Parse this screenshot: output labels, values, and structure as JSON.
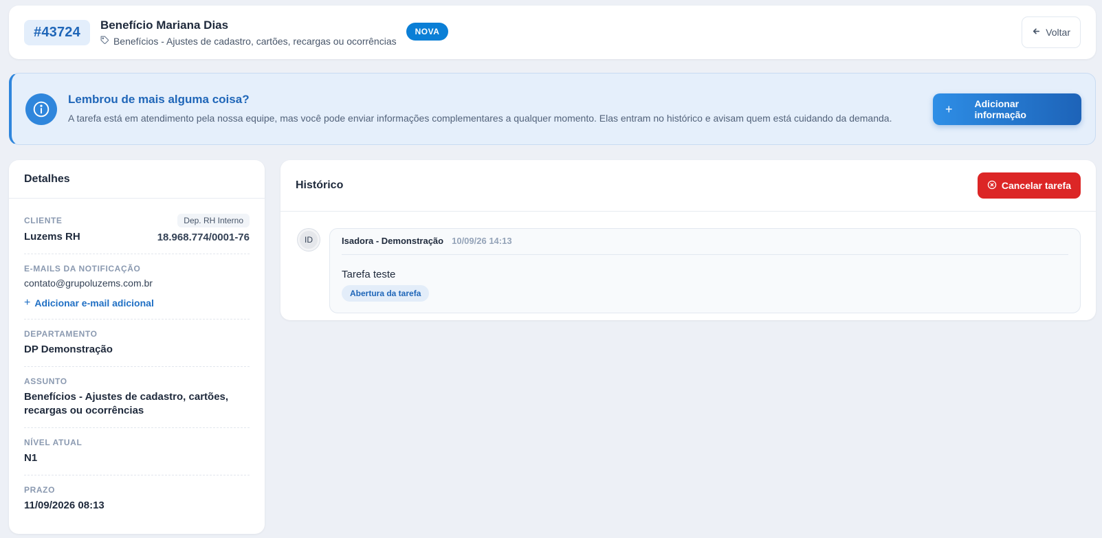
{
  "header": {
    "ticket_id": "#43724",
    "title": "Benefício Mariana Dias",
    "subject": "Benefícios - Ajustes de cadastro, cartões, recargas ou ocorrências",
    "status": "NOVA",
    "back_label": "Voltar"
  },
  "banner": {
    "title": "Lembrou de mais alguma coisa?",
    "description": "A tarefa está em atendimento pela nossa equipe, mas você pode enviar informações complementares a qualquer momento. Elas entram no histórico e avisam quem está cuidando da demanda.",
    "button_label": "Adicionar informação"
  },
  "details": {
    "heading": "Detalhes",
    "client_label": "CLIENTE",
    "client_tag": "Dep. RH Interno",
    "client_name": "Luzems RH",
    "client_cnpj": "18.968.774/0001-76",
    "emails_label": "E-MAILS DA NOTIFICAÇÃO",
    "email": "contato@grupoluzems.com.br",
    "add_email_label": "Adicionar e-mail adicional",
    "department_label": "DEPARTAMENTO",
    "department": "DP Demonstração",
    "subject_label": "ASSUNTO",
    "subject": "Benefícios - Ajustes de cadastro, cartões, recargas ou ocorrências",
    "level_label": "NÍVEL ATUAL",
    "level": "N1",
    "deadline_label": "PRAZO",
    "deadline": "11/09/2026 08:13"
  },
  "history": {
    "heading": "Histórico",
    "cancel_label": "Cancelar tarefa",
    "entries": [
      {
        "avatar_initials": "ID",
        "author": "Isadora - Demonstração",
        "time": "10/09/26 14:13",
        "text": "Tarefa teste",
        "tag": "Abertura da tarefa"
      }
    ]
  },
  "colors": {
    "accent": "#2f86dc",
    "ticket_text": "#1f66b8",
    "status_badge": "#0b7fd6",
    "danger": "#dc2626",
    "page_bg": "#edf0f6"
  },
  "icons": [
    "tag-icon",
    "arrow-left-icon",
    "info-icon",
    "plus-icon",
    "x-circle-icon"
  ]
}
